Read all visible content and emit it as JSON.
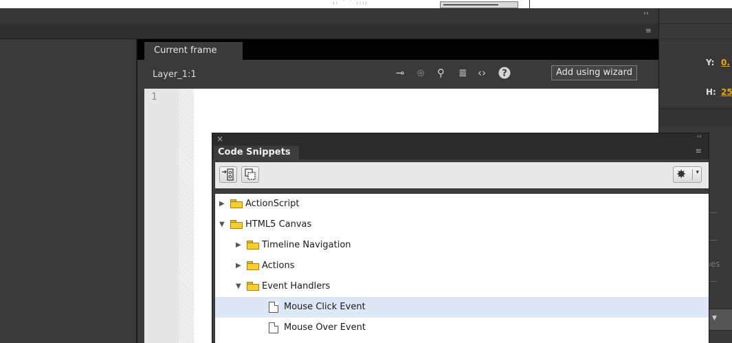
{
  "actions_panel": {
    "tab_current_frame": "Current frame",
    "layer_label": "Layer_1:1",
    "add_wizard_label": "Add using wizard",
    "line_number": "1"
  },
  "properties": {
    "y_label": "Y:",
    "y_value": "0.",
    "h_label": "H:",
    "h_value": "25",
    "partial_text": "shes",
    "accent_color": "#e8a900"
  },
  "code_snippets": {
    "title": "Code Snippets",
    "tree": [
      {
        "label": "ActionScript",
        "level": 0,
        "type": "folder",
        "expanded": false
      },
      {
        "label": "HTML5 Canvas",
        "level": 0,
        "type": "folder",
        "expanded": true
      },
      {
        "label": "Timeline Navigation",
        "level": 1,
        "type": "folder",
        "expanded": false
      },
      {
        "label": "Actions",
        "level": 1,
        "type": "folder",
        "expanded": false
      },
      {
        "label": "Event Handlers",
        "level": 1,
        "type": "folder",
        "expanded": true
      },
      {
        "label": "Mouse Click Event",
        "level": 2,
        "type": "snippet",
        "selected": true
      },
      {
        "label": "Mouse Over Event",
        "level": 2,
        "type": "snippet",
        "selected": false
      }
    ]
  }
}
